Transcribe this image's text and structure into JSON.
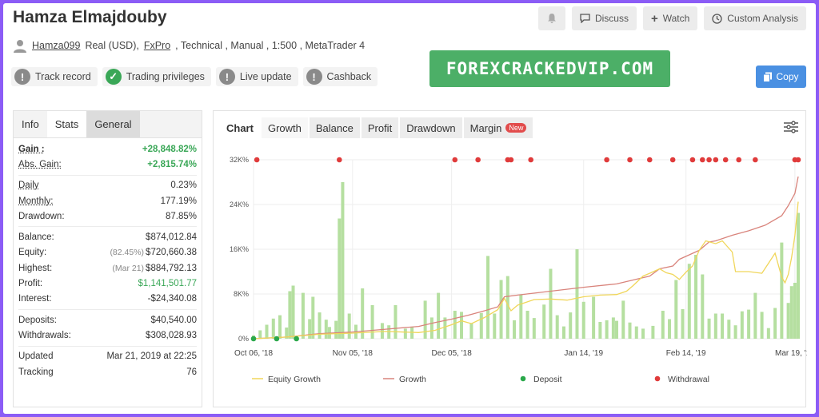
{
  "header": {
    "title": "Hamza Elmajdouby",
    "discuss_label": "Discuss",
    "watch_label": "Watch",
    "custom_analysis_label": "Custom Analysis"
  },
  "account": {
    "username": "Hamza099",
    "type": "Real (USD),",
    "broker": "FxPro",
    "details": ", Technical , Manual , 1:500 , MetaTrader 4"
  },
  "badges": [
    {
      "label": "Track record",
      "icon": "exclamation-icon",
      "color": "#8a8a8a"
    },
    {
      "label": "Trading privileges",
      "icon": "check-icon",
      "color": "#3aa757"
    },
    {
      "label": "Live update",
      "icon": "exclamation-icon",
      "color": "#8a8a8a"
    },
    {
      "label": "Cashback",
      "icon": "exclamation-icon",
      "color": "#8a8a8a"
    }
  ],
  "banner": {
    "text": "FOREXCRACKEDVIP.COM",
    "color": "#4caf67"
  },
  "copy_label": "Copy",
  "left_tabs": [
    "Info",
    "Stats",
    "General"
  ],
  "stats": {
    "gain": {
      "label": "Gain :",
      "value": "+28,848.82%"
    },
    "abs_gain": {
      "label": "Abs. Gain:",
      "value": "+2,815.74%"
    },
    "daily": {
      "label": "Daily",
      "value": "0.23%"
    },
    "monthly": {
      "label": "Monthly:",
      "value": "177.19%"
    },
    "drawdown": {
      "label": "Drawdown:",
      "value": "87.85%"
    },
    "balance": {
      "label": "Balance:",
      "value": "$874,012.84"
    },
    "equity": {
      "label": "Equity:",
      "sub": "(82.45%)",
      "value": "$720,660.38"
    },
    "highest": {
      "label": "Highest:",
      "sub": "(Mar 21)",
      "value": "$884,792.13"
    },
    "profit": {
      "label": "Profit:",
      "value": "$1,141,501.77"
    },
    "interest": {
      "label": "Interest:",
      "value": "-$24,340.08"
    },
    "deposits": {
      "label": "Deposits:",
      "value": "$40,540.00"
    },
    "withdrawals": {
      "label": "Withdrawals:",
      "value": "$308,028.93"
    },
    "updated": {
      "label": "Updated",
      "value": "Mar 21, 2019 at 22:25"
    },
    "tracking": {
      "label": "Tracking",
      "value": "76"
    }
  },
  "chart_tabs": [
    {
      "label": "Chart"
    },
    {
      "label": "Growth"
    },
    {
      "label": "Balance"
    },
    {
      "label": "Profit"
    },
    {
      "label": "Drawdown"
    },
    {
      "label": "Margin",
      "tag": "New"
    }
  ],
  "chart_data": {
    "type": "line",
    "yticks": [
      "0%",
      "8K%",
      "16K%",
      "24K%",
      "32K%"
    ],
    "ylim": [
      0,
      32000
    ],
    "xticks": [
      "Oct 06, '18",
      "Nov 05, '18",
      "Dec 05, '18",
      "Jan 14, '19",
      "Feb 14, '19",
      "Mar 19, '19"
    ],
    "x_range_days": [
      0,
      165
    ],
    "xtick_days": [
      0,
      30,
      60,
      100,
      131,
      164
    ],
    "legend": [
      "Equity Growth",
      "Growth",
      "Deposit",
      "Withdrawal"
    ],
    "colors": {
      "equity": "#f0d65a",
      "growth": "#d9847c",
      "deposit": "#2aa84a",
      "withdrawal": "#e03b3b",
      "bars": "#b5dfa0"
    },
    "growth": [
      [
        0,
        0
      ],
      [
        10,
        300
      ],
      [
        20,
        900
      ],
      [
        30,
        1200
      ],
      [
        40,
        1700
      ],
      [
        50,
        2200
      ],
      [
        55,
        2900
      ],
      [
        60,
        3500
      ],
      [
        65,
        4200
      ],
      [
        70,
        5000
      ],
      [
        74,
        5700
      ],
      [
        76,
        7500
      ],
      [
        80,
        7800
      ],
      [
        90,
        8500
      ],
      [
        100,
        9200
      ],
      [
        110,
        9800
      ],
      [
        115,
        10500
      ],
      [
        120,
        11200
      ],
      [
        123,
        12500
      ],
      [
        127,
        13000
      ],
      [
        129,
        14200
      ],
      [
        132,
        15000
      ],
      [
        135,
        15800
      ],
      [
        138,
        17300
      ],
      [
        140,
        17500
      ],
      [
        145,
        18500
      ],
      [
        150,
        19300
      ],
      [
        155,
        20300
      ],
      [
        160,
        22000
      ],
      [
        162,
        23800
      ],
      [
        164,
        26000
      ],
      [
        165,
        29000
      ]
    ],
    "equity_growth": [
      [
        0,
        0
      ],
      [
        10,
        300
      ],
      [
        20,
        800
      ],
      [
        30,
        1000
      ],
      [
        40,
        1300
      ],
      [
        50,
        1100
      ],
      [
        55,
        1500
      ],
      [
        60,
        2500
      ],
      [
        63,
        3200
      ],
      [
        66,
        2700
      ],
      [
        70,
        3800
      ],
      [
        74,
        5200
      ],
      [
        76,
        7200
      ],
      [
        78,
        5000
      ],
      [
        80,
        6000
      ],
      [
        85,
        7000
      ],
      [
        90,
        7100
      ],
      [
        95,
        6900
      ],
      [
        100,
        7500
      ],
      [
        105,
        7800
      ],
      [
        110,
        7900
      ],
      [
        113,
        8500
      ],
      [
        115,
        9500
      ],
      [
        118,
        11200
      ],
      [
        120,
        11700
      ],
      [
        123,
        12500
      ],
      [
        125,
        11800
      ],
      [
        127,
        11500
      ],
      [
        129,
        10600
      ],
      [
        131,
        11900
      ],
      [
        133,
        13000
      ],
      [
        135,
        15800
      ],
      [
        137,
        17500
      ],
      [
        140,
        17000
      ],
      [
        142,
        17500
      ],
      [
        145,
        15500
      ],
      [
        146,
        12000
      ],
      [
        150,
        12000
      ],
      [
        154,
        11700
      ],
      [
        156,
        13500
      ],
      [
        158,
        15300
      ],
      [
        160,
        11000
      ],
      [
        161,
        10000
      ],
      [
        162,
        11500
      ],
      [
        163,
        14500
      ],
      [
        164,
        18500
      ],
      [
        165,
        24500
      ]
    ],
    "bars": [
      [
        0,
        600
      ],
      [
        2,
        1500
      ],
      [
        4,
        2500
      ],
      [
        6,
        3600
      ],
      [
        8,
        4200
      ],
      [
        10,
        2000
      ],
      [
        11,
        8500
      ],
      [
        12,
        9500
      ],
      [
        15,
        8200
      ],
      [
        17,
        3500
      ],
      [
        18,
        7500
      ],
      [
        20,
        4700
      ],
      [
        22,
        3400
      ],
      [
        23,
        2100
      ],
      [
        25,
        3200
      ],
      [
        26,
        21500
      ],
      [
        27,
        28000
      ],
      [
        29,
        4500
      ],
      [
        31,
        2500
      ],
      [
        33,
        9000
      ],
      [
        36,
        6000
      ],
      [
        39,
        2800
      ],
      [
        41,
        2400
      ],
      [
        43,
        6000
      ],
      [
        46,
        1800
      ],
      [
        48,
        2100
      ],
      [
        52,
        6800
      ],
      [
        54,
        3800
      ],
      [
        56,
        8200
      ],
      [
        58,
        3800
      ],
      [
        61,
        5000
      ],
      [
        63,
        4800
      ],
      [
        66,
        2800
      ],
      [
        69,
        4600
      ],
      [
        71,
        14800
      ],
      [
        73,
        4500
      ],
      [
        75,
        10500
      ],
      [
        77,
        11200
      ],
      [
        79,
        3300
      ],
      [
        81,
        7900
      ],
      [
        83,
        5000
      ],
      [
        85,
        3700
      ],
      [
        88,
        6100
      ],
      [
        90,
        12500
      ],
      [
        92,
        4200
      ],
      [
        94,
        2200
      ],
      [
        96,
        4700
      ],
      [
        98,
        16000
      ],
      [
        100,
        6600
      ],
      [
        103,
        7500
      ],
      [
        105,
        3000
      ],
      [
        107,
        3300
      ],
      [
        109,
        3800
      ],
      [
        110,
        3200
      ],
      [
        112,
        6800
      ],
      [
        114,
        2900
      ],
      [
        116,
        2200
      ],
      [
        118,
        1800
      ],
      [
        121,
        2300
      ],
      [
        124,
        5000
      ],
      [
        126,
        3500
      ],
      [
        128,
        10500
      ],
      [
        130,
        5300
      ],
      [
        132,
        13400
      ],
      [
        134,
        15000
      ],
      [
        136,
        11500
      ],
      [
        138,
        3600
      ],
      [
        140,
        4500
      ],
      [
        142,
        4500
      ],
      [
        144,
        3400
      ],
      [
        146,
        2400
      ],
      [
        148,
        4900
      ],
      [
        150,
        5200
      ],
      [
        152,
        8200
      ],
      [
        154,
        4800
      ],
      [
        156,
        1900
      ],
      [
        158,
        5500
      ],
      [
        160,
        17200
      ],
      [
        162,
        6400
      ],
      [
        163,
        9400
      ],
      [
        164,
        10000
      ],
      [
        165,
        22500
      ]
    ],
    "deposits": [
      0,
      7,
      13
    ],
    "withdrawals": [
      1,
      26,
      61,
      68,
      77,
      78,
      84,
      107,
      114,
      120,
      127,
      133,
      136,
      138,
      140,
      143,
      147,
      152,
      164,
      165
    ]
  }
}
